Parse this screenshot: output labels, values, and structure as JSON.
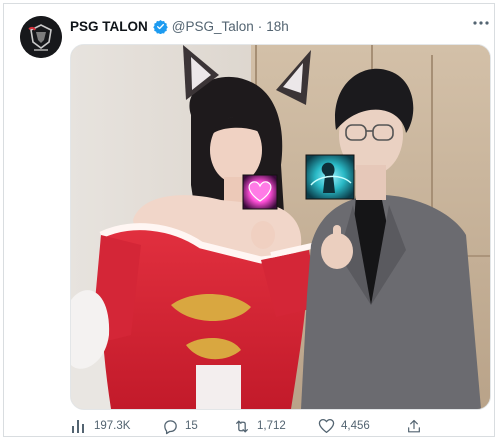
{
  "tweet": {
    "author": {
      "name": "PSG TALON",
      "handle": "@PSG_Talon",
      "separator": "·",
      "time": "18h",
      "verified": true,
      "avatar_icon": "psg-talon-logo"
    },
    "more_icon": "more-dots-icon",
    "media": {
      "stickers": [
        "heart-emote-icon",
        "champion-emote-icon"
      ]
    },
    "stats": {
      "views": "197.3K",
      "replies": "15",
      "retweets": "1,712",
      "likes": "4,456"
    },
    "icons": {
      "views": "analytics-icon",
      "replies": "reply-icon",
      "retweets": "retweet-icon",
      "likes": "heart-icon",
      "share": "share-icon"
    },
    "colors": {
      "verified": "#1d9bf0",
      "secondary_text": "#536471",
      "text": "#0f1419"
    }
  }
}
